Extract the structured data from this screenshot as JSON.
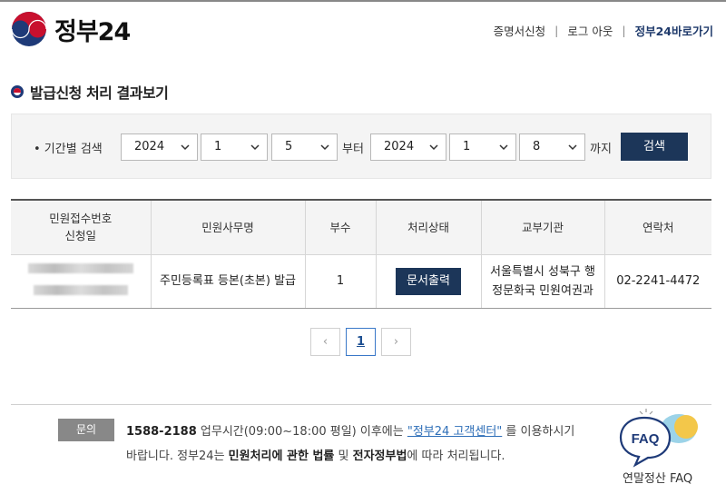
{
  "header": {
    "logo_text": "정부24",
    "links": [
      "증명서신청",
      "로그 아웃",
      "정부24바로가기"
    ]
  },
  "page": {
    "title": "발급신청 처리 결과보기"
  },
  "search": {
    "label": "• 기간별 검색",
    "from_year": "2024",
    "from_month": "1",
    "from_day": "5",
    "from_word": "부터",
    "to_year": "2024",
    "to_month": "1",
    "to_day": "8",
    "to_word": "까지",
    "button": "검색"
  },
  "table": {
    "headers": {
      "col1_line1": "민원접수번호",
      "col1_line2": "신청일",
      "col2": "민원사무명",
      "col3": "부수",
      "col4": "처리상태",
      "col5": "교부기관",
      "col6": "연락처"
    },
    "rows": [
      {
        "name": "주민등록표 등본(초본) 발급",
        "count": "1",
        "status_button": "문서출력",
        "agency_line1": "서울특별시 성북구 행",
        "agency_line2": "정문화국 민원여권과",
        "phone": "02-2241-4472"
      }
    ]
  },
  "pagination": {
    "prev": "‹",
    "current": "1",
    "next": "›"
  },
  "footer": {
    "badge": "문의",
    "phone": "1588-2188",
    "line1_mid": " 업무시간(09:00~18:00 평일) 이후에는 ",
    "link": "\"정부24 고객센터\"",
    "line1_end": " 를 이용하시기",
    "line2_a": "바랍니다. 정부24는 ",
    "line2_b": "민원처리에 관한 법률",
    "line2_c": " 및 ",
    "line2_d": "전자정부법",
    "line2_e": "에 따라 처리됩니다."
  },
  "faq": {
    "bubble": "FAQ",
    "label": "연말정산 FAQ"
  },
  "colors": {
    "navy": "#1c3659",
    "link": "#2f6fb8",
    "logo_red": "#c8102e",
    "logo_blue": "#1e3a78"
  }
}
